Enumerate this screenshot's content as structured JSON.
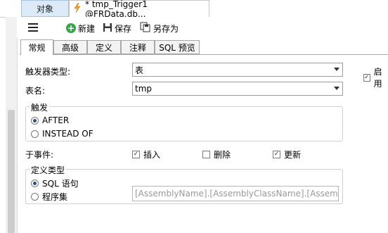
{
  "doc_tabs": [
    {
      "label": "对象"
    },
    {
      "label": "* tmp_Trigger1 @FRData.db..."
    }
  ],
  "toolbar": {
    "new_label": "新建",
    "save_label": "保存",
    "save_as_label": "另存为"
  },
  "subtabs": [
    {
      "label": "常规"
    },
    {
      "label": "高级"
    },
    {
      "label": "定义"
    },
    {
      "label": "注释"
    },
    {
      "label": "SQL 预览"
    }
  ],
  "form": {
    "trigger_type_label": "触发器类型:",
    "trigger_type_value": "表",
    "enable_label": "启用",
    "table_name_label": "表名:",
    "table_name_value": "tmp",
    "fire_group_title": "触发",
    "fire_options": [
      "AFTER",
      "INSTEAD OF"
    ],
    "on_event_label": "于事件:",
    "events": [
      {
        "label": "插入",
        "checked": true
      },
      {
        "label": "删除",
        "checked": false
      },
      {
        "label": "更新",
        "checked": true
      }
    ],
    "def_group_title": "定义类型",
    "def_options": [
      "SQL 语句",
      "程序集"
    ],
    "assembly_placeholder": "[AssemblyName].[AssemblyClassName].[AssemblyMethodName]"
  }
}
